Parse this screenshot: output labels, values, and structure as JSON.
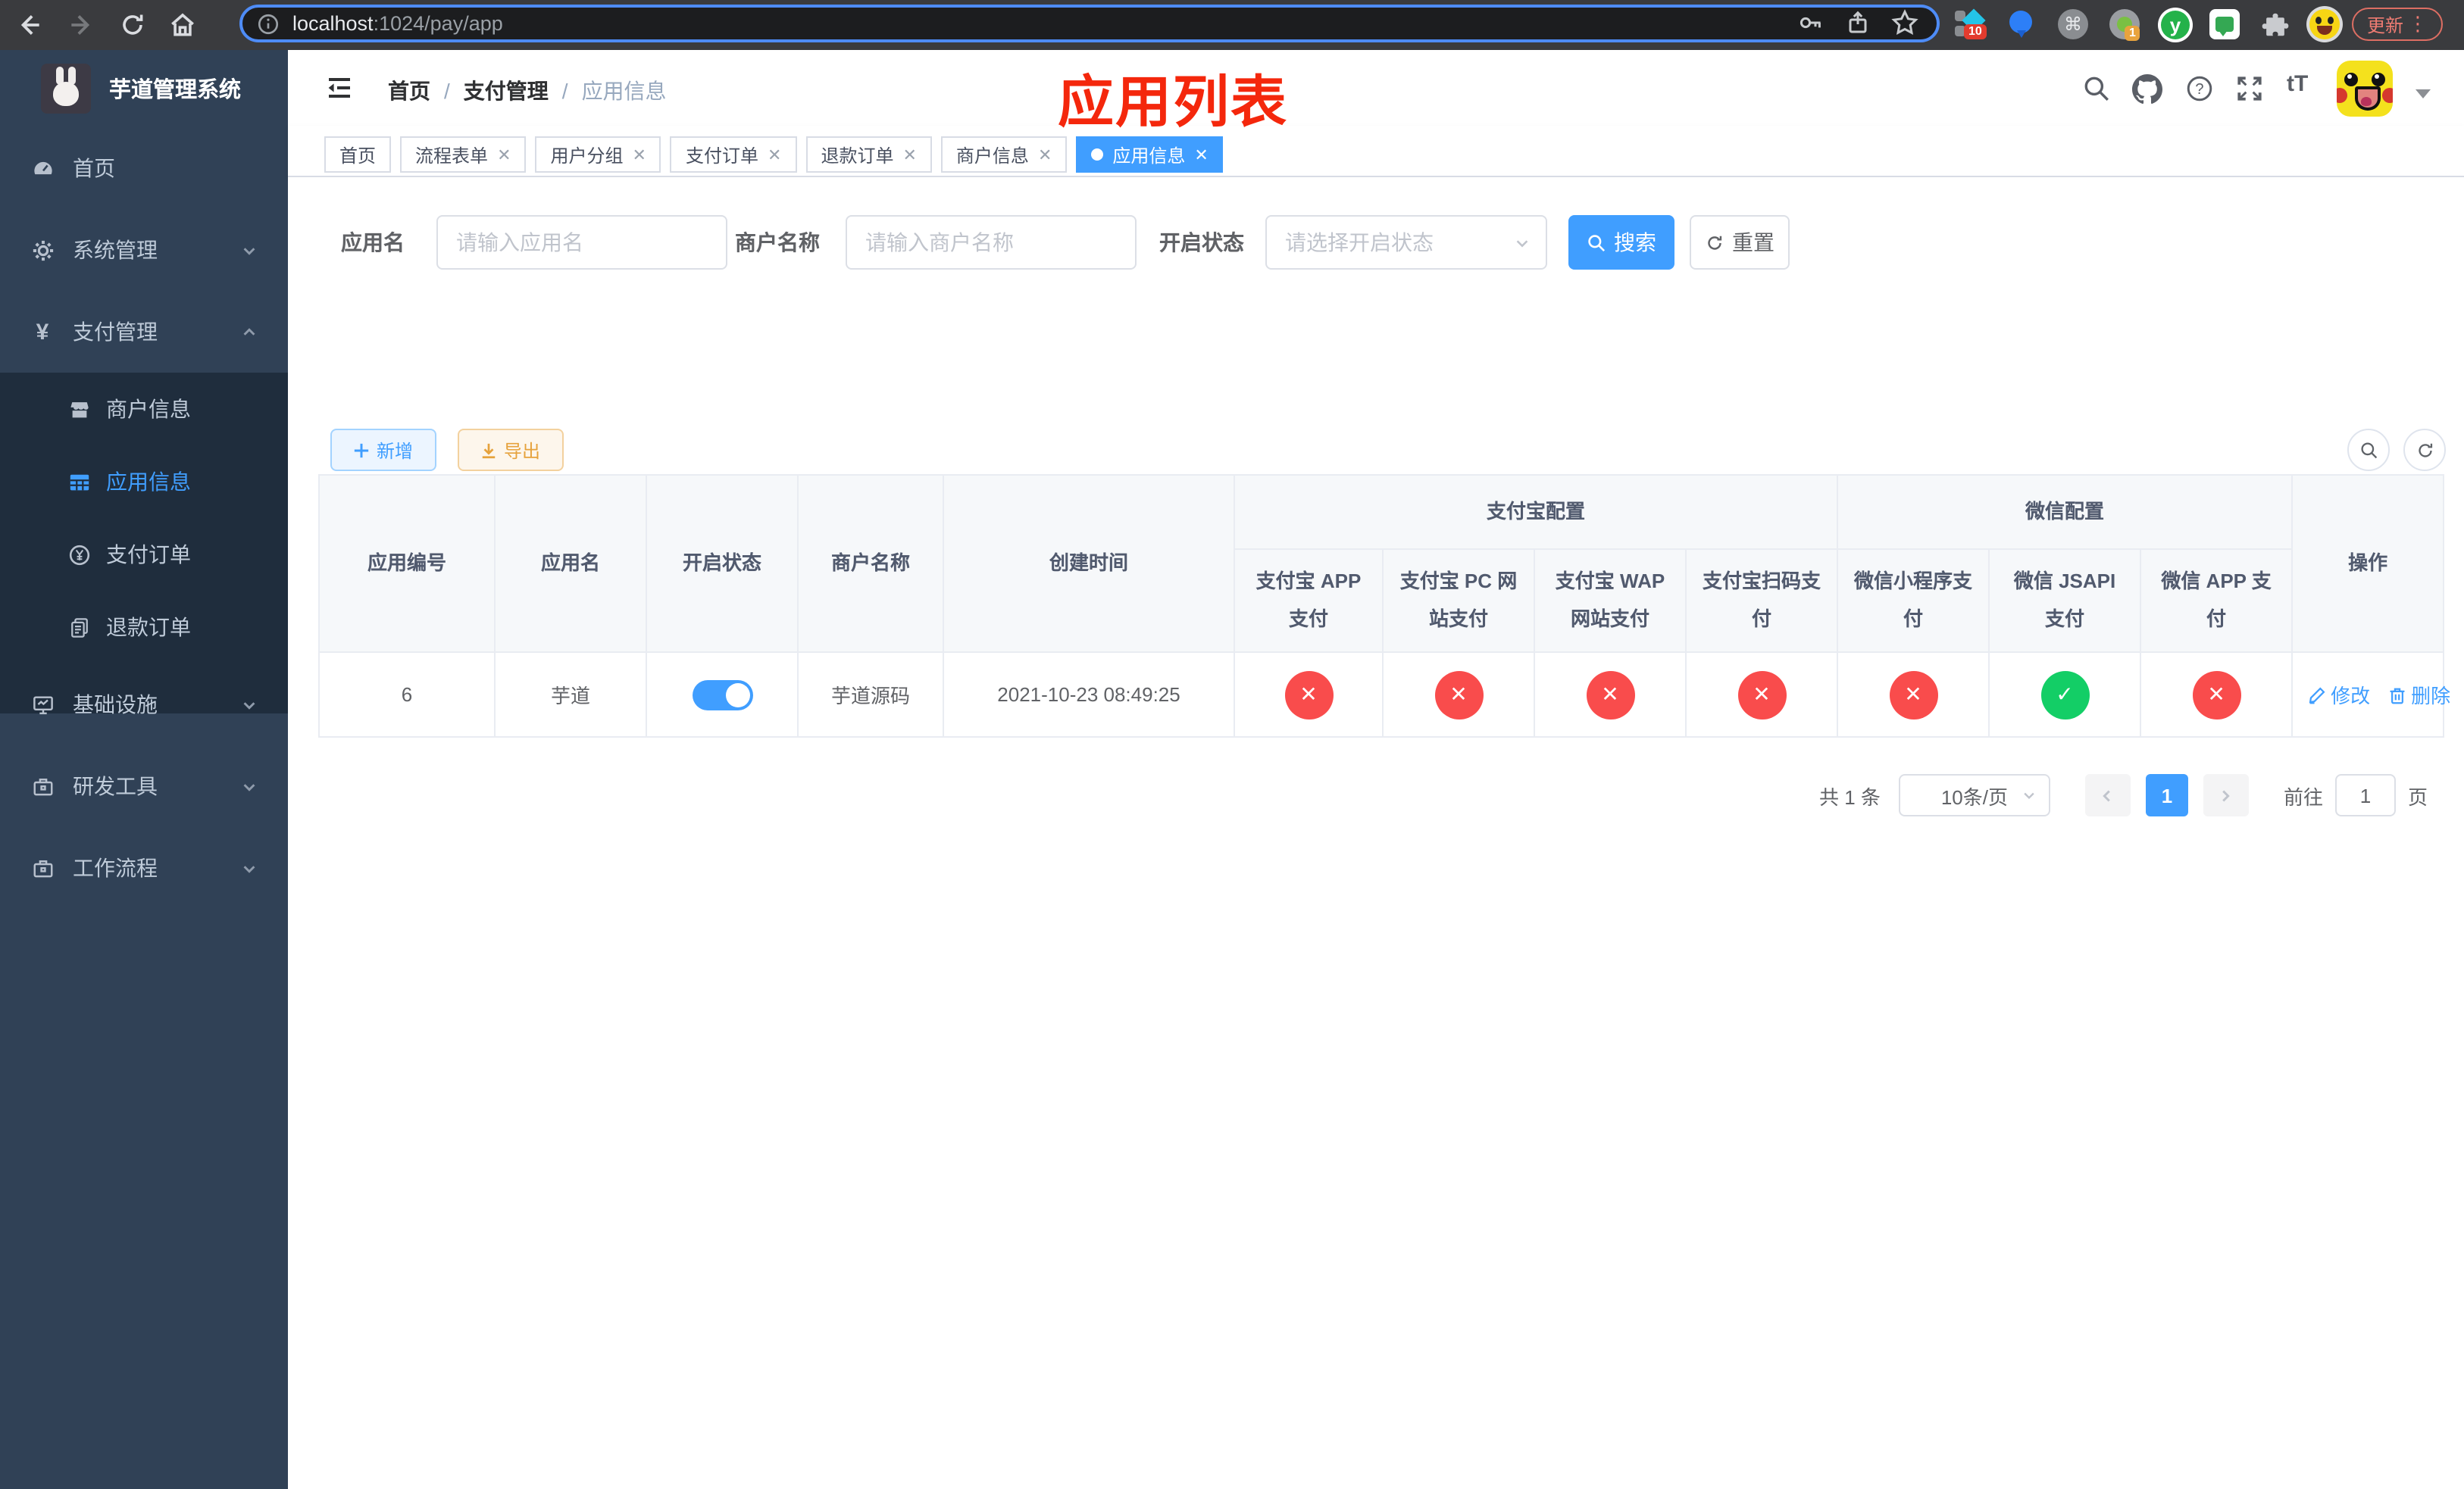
{
  "browser": {
    "url_host": "localhost",
    "url_rest": ":1024/pay/app",
    "update_label": "更新",
    "ext_badge_a": "10",
    "ext_badge_b": "1"
  },
  "icons": {
    "command_glyph": "⌘",
    "kebab_glyph": "⋮",
    "yen_glyph": "¥",
    "question_glyph": "?",
    "y_badge_glyph": "y",
    "font_size_glyph": "tT",
    "pen_glyph": "✎"
  },
  "sidebar": {
    "logo_title": "芋道管理系统",
    "items": [
      {
        "label": "首页"
      },
      {
        "label": "系统管理"
      },
      {
        "label": "支付管理"
      },
      {
        "label": "商户信息"
      },
      {
        "label": "应用信息"
      },
      {
        "label": "支付订单"
      },
      {
        "label": "退款订单"
      },
      {
        "label": "基础设施"
      },
      {
        "label": "研发工具"
      },
      {
        "label": "工作流程"
      }
    ]
  },
  "navbar": {
    "breadcrumb_home": "首页",
    "breadcrumb_section": "支付管理",
    "breadcrumb_current": "应用信息",
    "annotation": "应用列表"
  },
  "tabs": [
    {
      "label": "首页"
    },
    {
      "label": "流程表单"
    },
    {
      "label": "用户分组"
    },
    {
      "label": "支付订单"
    },
    {
      "label": "退款订单"
    },
    {
      "label": "商户信息"
    },
    {
      "label": "应用信息"
    }
  ],
  "filters": {
    "app_name_label": "应用名",
    "app_name_placeholder": "请输入应用名",
    "merchant_label": "商户名称",
    "merchant_placeholder": "请输入商户名称",
    "status_label": "开启状态",
    "status_placeholder": "请选择开启状态",
    "search_label": "搜索",
    "reset_label": "重置"
  },
  "toolbar": {
    "add_label": "新增",
    "export_label": "导出"
  },
  "table": {
    "headers": {
      "app_id": "应用编号",
      "app_name": "应用名",
      "status": "开启状态",
      "merchant": "商户名称",
      "created": "创建时间",
      "alipay_group": "支付宝配置",
      "wechat_group": "微信配置",
      "actions": "操作",
      "alipay_app": "支付宝 APP 支付",
      "alipay_pc": "支付宝 PC 网站支付",
      "alipay_wap": "支付宝 WAP 网站支付",
      "alipay_qr": "支付宝扫码支付",
      "wx_mini": "微信小程序支付",
      "wx_jsapi": "微信 JSAPI 支付",
      "wx_app": "微信 APP 支付"
    },
    "row": {
      "app_id": "6",
      "app_name": "芋道",
      "status_on": true,
      "merchant": "芋道源码",
      "created": "2021-10-23 08:49:25",
      "statuses": [
        "fail",
        "fail",
        "fail",
        "fail",
        "fail",
        "success",
        "fail"
      ],
      "edit_label": "修改",
      "delete_label": "删除"
    }
  },
  "pagination": {
    "total": "共 1 条",
    "page_size": "10条/页",
    "current_page": "1",
    "goto_label": "前往",
    "goto_value": "1",
    "unit_label": "页"
  },
  "colors": {
    "accent": "#409eff",
    "danger": "#f94c4c",
    "success": "#13ce66",
    "warning": "#e6a23c",
    "sidebar_bg": "#304156",
    "submenu_bg": "#1f2d3d",
    "annotation_red": "#f4270c"
  }
}
